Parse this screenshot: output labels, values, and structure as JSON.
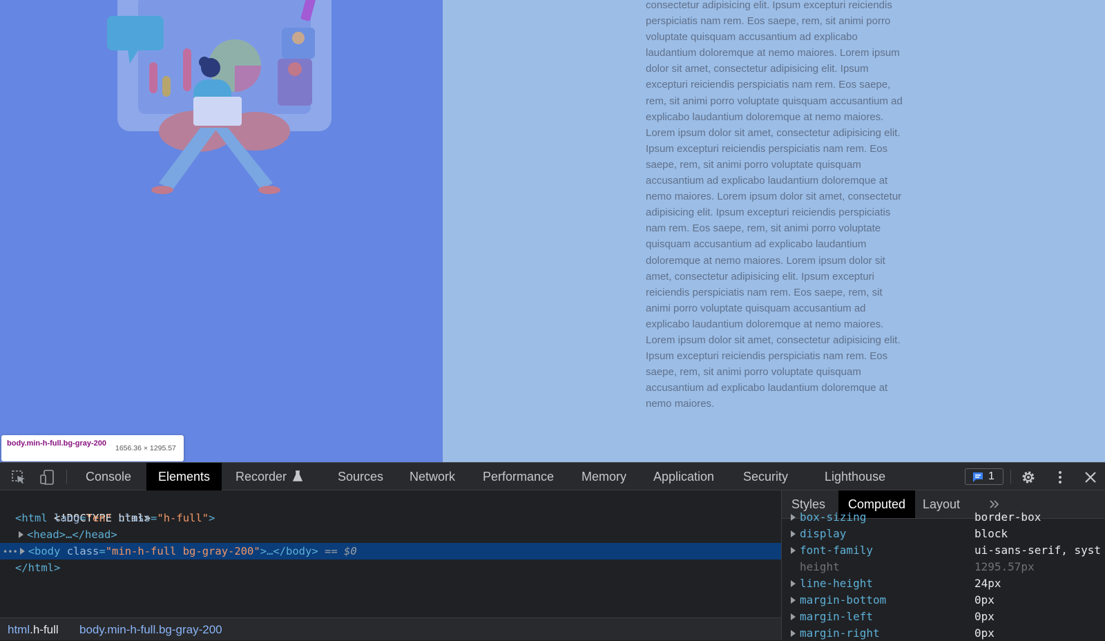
{
  "page": {
    "lorem_text": "consectetur adipisicing elit. Ipsum excepturi reiciendis perspiciatis nam rem. Eos saepe, rem, sit animi porro voluptate quisquam accusantium ad explicabo laudantium doloremque at nemo maiores. Lorem ipsum dolor sit amet, consectetur adipisicing elit. Ipsum excepturi reiciendis perspiciatis nam rem. Eos saepe, rem, sit animi porro voluptate quisquam accusantium ad explicabo laudantium doloremque at nemo maiores. Lorem ipsum dolor sit amet, consectetur adipisicing elit. Ipsum excepturi reiciendis perspiciatis nam rem. Eos saepe, rem, sit animi porro voluptate quisquam accusantium ad explicabo laudantium doloremque at nemo maiores. Lorem ipsum dolor sit amet, consectetur adipisicing elit. Ipsum excepturi reiciendis perspiciatis nam rem. Eos saepe, rem, sit animi porro voluptate quisquam accusantium ad explicabo laudantium doloremque at nemo maiores. Lorem ipsum dolor sit amet, consectetur adipisicing elit. Ipsum excepturi reiciendis perspiciatis nam rem. Eos saepe, rem, sit animi porro voluptate quisquam accusantium ad explicabo laudantium doloremque at nemo maiores. Lorem ipsum dolor sit amet, consectetur adipisicing elit. Ipsum excepturi reiciendis perspiciatis nam rem. Eos saepe, rem, sit animi porro voluptate quisquam accusantium ad explicabo laudantium doloremque at nemo maiores."
  },
  "inspect_tooltip": {
    "selector": "body.min-h-full.bg-gray-200",
    "dimensions": "1656.36 × 1295.57"
  },
  "devtools": {
    "tabs": [
      {
        "label": "Console"
      },
      {
        "label": "Elements"
      },
      {
        "label": "Recorder"
      },
      {
        "label": "Sources"
      },
      {
        "label": "Network"
      },
      {
        "label": "Performance"
      },
      {
        "label": "Memory"
      },
      {
        "label": "Application"
      },
      {
        "label": "Security"
      },
      {
        "label": "Lighthouse"
      }
    ],
    "issues_count": "1",
    "dom": {
      "doctype": "<!DOCTYPE html>",
      "html_open": "<html",
      "html_lang_attr": "lang",
      "html_lang_val": "\"en\"",
      "html_class_attr": "class",
      "html_class_val": "\"h-full\"",
      "html_close_bracket": ">",
      "head": "<head>…</head>",
      "body_open": "<body",
      "body_class_attr": "class",
      "body_class_val": "\"min-h-full bg-gray-200\"",
      "body_rest": ">…</body>",
      "body_marker": "== $0",
      "html_close": "</html>",
      "dots": "•••"
    },
    "breadcrumb": [
      {
        "tag": "html",
        "cls": ".h-full"
      },
      {
        "tag": "body",
        "cls": ".min-h-full.bg-gray-200"
      }
    ],
    "side_tabs": [
      {
        "label": "Styles"
      },
      {
        "label": "Computed"
      },
      {
        "label": "Layout"
      }
    ],
    "computed": [
      {
        "name": "box-sizing",
        "value": "border-box"
      },
      {
        "name": "display",
        "value": "block"
      },
      {
        "name": "font-family",
        "value": "ui-sans-serif, syst"
      },
      {
        "name": "height",
        "value": "1295.57px"
      },
      {
        "name": "line-height",
        "value": "24px"
      },
      {
        "name": "margin-bottom",
        "value": "0px"
      },
      {
        "name": "margin-left",
        "value": "0px"
      },
      {
        "name": "margin-right",
        "value": "0px"
      }
    ]
  }
}
